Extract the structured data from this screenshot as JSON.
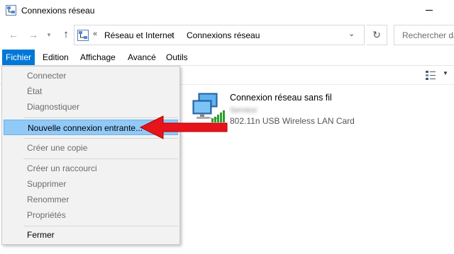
{
  "window": {
    "title": "Connexions réseau"
  },
  "nav": {
    "back_glyph": "←",
    "forward_glyph": "→",
    "recent_glyph": "▾",
    "up_glyph": "↑",
    "refresh_glyph": "↻",
    "address_chevrons": "«",
    "address_segments": [
      "Réseau et Internet",
      "Connexions réseau"
    ],
    "address_separator": "›",
    "address_dropdown_glyph": "⌄",
    "search_placeholder": "Rechercher dans"
  },
  "menubar": {
    "items": [
      "Fichier",
      "Edition",
      "Affichage",
      "Avancé",
      "Outils"
    ],
    "active": "Fichier"
  },
  "file_menu": {
    "groups": [
      [
        {
          "label": "Connecter",
          "enabled": false
        },
        {
          "label": "État",
          "enabled": false
        },
        {
          "label": "Diagnostiquer",
          "enabled": false
        }
      ],
      [
        {
          "label": "Nouvelle connexion entrante...",
          "enabled": true,
          "highlighted": true
        }
      ],
      [
        {
          "label": "Créer une copie",
          "enabled": false
        }
      ],
      [
        {
          "label": "Créer un raccourci",
          "enabled": false
        },
        {
          "label": "Supprimer",
          "enabled": false
        },
        {
          "label": "Renommer",
          "enabled": false
        },
        {
          "label": "Propriétés",
          "enabled": false
        }
      ],
      [
        {
          "label": "Fermer",
          "enabled": true
        }
      ]
    ]
  },
  "connection": {
    "name": "Connexion réseau sans fil",
    "ssid": "Serveur",
    "device": "802.11n USB Wireless LAN Card",
    "icon": "wireless-network-icon"
  },
  "colors": {
    "menu_active": "#0078d7",
    "highlight": "#91c9f7",
    "arrow": "#e8141b"
  }
}
